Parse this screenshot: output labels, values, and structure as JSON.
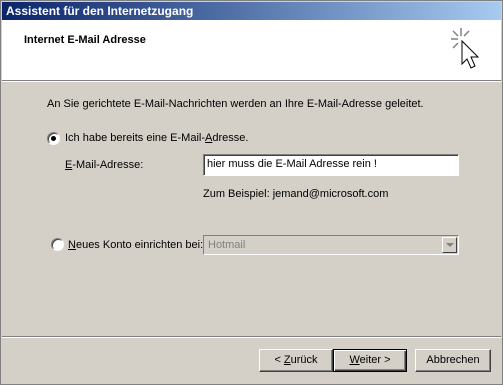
{
  "window": {
    "title": "Assistent für den Internetzugang"
  },
  "header": {
    "title": "Internet E-Mail Adresse",
    "icon": "wizard-sparkle-cursor-icon"
  },
  "intro": "An Sie gerichtete E-Mail-Nachrichten werden an Ihre E-Mail-Adresse geleitet.",
  "option_existing": {
    "label_pre": "Ich habe bereits eine E-Mail-",
    "label_u": "A",
    "label_post": "dresse.",
    "selected": true
  },
  "email": {
    "label_u": "E",
    "label_post": "-Mail-Adresse:",
    "value": "hier muss die E-Mail Adresse rein !",
    "example": "Zum Beispiel: jemand@microsoft.com"
  },
  "option_new": {
    "label_u": "N",
    "label_post": "eues Konto einrichten bei:",
    "selected": false,
    "combo_value": "Hotmail"
  },
  "buttons": {
    "back": {
      "pre": "< ",
      "u": "Z",
      "post": "urück"
    },
    "next": {
      "pre": "",
      "u": "W",
      "post": "eiter >"
    },
    "cancel": "Abbrechen"
  }
}
